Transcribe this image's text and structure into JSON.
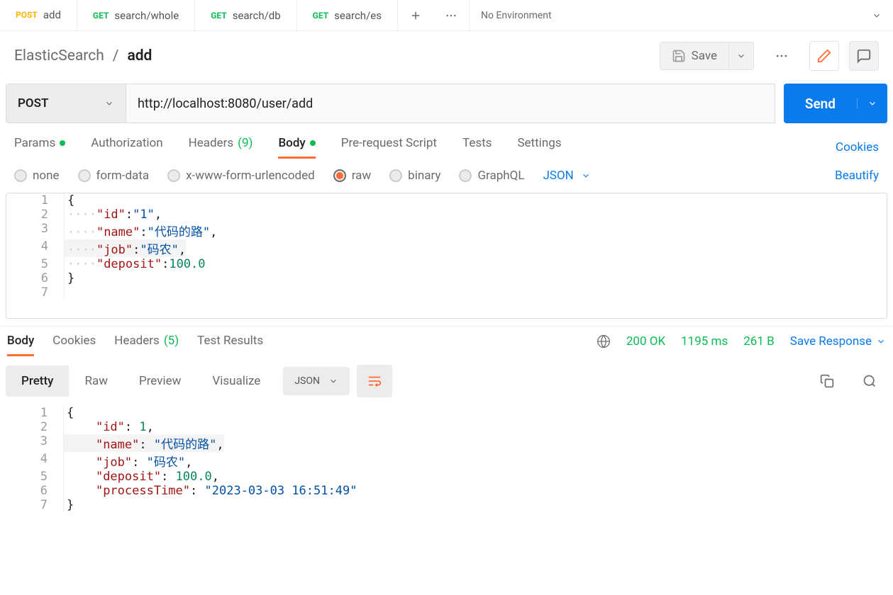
{
  "tabs": [
    {
      "method": "POST",
      "name": "add",
      "mclass": "post"
    },
    {
      "method": "GET",
      "name": "search/whole",
      "mclass": "get"
    },
    {
      "method": "GET",
      "name": "search/db",
      "mclass": "get"
    },
    {
      "method": "GET",
      "name": "search/es",
      "mclass": "get"
    }
  ],
  "environment": "No Environment",
  "breadcrumb": {
    "collection": "ElasticSearch",
    "sep": "/",
    "name": "add"
  },
  "save_label": "Save",
  "method": "POST",
  "url": "http://localhost:8080/user/add",
  "send_label": "Send",
  "request_tabs": {
    "params": "Params",
    "auth": "Authorization",
    "headers": "Headers",
    "headers_count": "(9)",
    "body": "Body",
    "prescript": "Pre-request Script",
    "tests": "Tests",
    "settings": "Settings",
    "cookies": "Cookies"
  },
  "body_types": {
    "none": "none",
    "formdata": "form-data",
    "xwww": "x-www-form-urlencoded",
    "raw": "raw",
    "binary": "binary",
    "graphql": "GraphQL",
    "format": "JSON",
    "beautify": "Beautify"
  },
  "request_body": {
    "l1": "{",
    "l2": {
      "key": "\"id\"",
      "val": "\"1\""
    },
    "l3": {
      "key": "\"name\"",
      "val": "\"代码的路\""
    },
    "l4": {
      "key": "\"job\"",
      "val": "\"码农\""
    },
    "l5": {
      "key": "\"deposit\"",
      "val": "100.0"
    },
    "l6": "}"
  },
  "response_tabs": {
    "body": "Body",
    "cookies": "Cookies",
    "headers": "Headers",
    "headers_count": "(5)",
    "test": "Test Results"
  },
  "response_meta": {
    "status": "200 OK",
    "time": "1195 ms",
    "size": "261 B",
    "save": "Save Response"
  },
  "response_view": {
    "pretty": "Pretty",
    "raw": "Raw",
    "preview": "Preview",
    "visualize": "Visualize",
    "format": "JSON"
  },
  "response_body": {
    "l1": "{",
    "l2": {
      "key": "\"id\"",
      "val": "1"
    },
    "l3": {
      "key": "\"name\"",
      "val": "\"代码的路\""
    },
    "l4": {
      "key": "\"job\"",
      "val": "\"码农\""
    },
    "l5": {
      "key": "\"deposit\"",
      "val": "100.0"
    },
    "l6": {
      "key": "\"processTime\"",
      "val": "\"2023-03-03 16:51:49\""
    },
    "l7": "}"
  },
  "lineno": {
    "n1": "1",
    "n2": "2",
    "n3": "3",
    "n4": "4",
    "n5": "5",
    "n6": "6",
    "n7": "7"
  }
}
